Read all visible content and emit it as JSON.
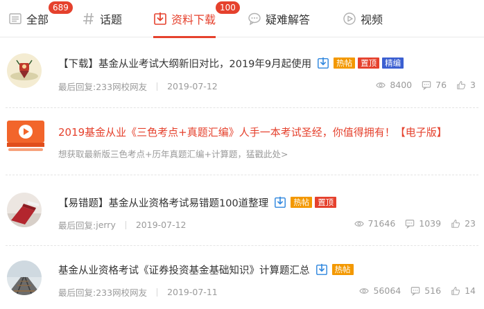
{
  "tabs": [
    {
      "label": "全部",
      "badge": "689",
      "icon": "list-icon",
      "active": false
    },
    {
      "label": "话题",
      "badge": "",
      "icon": "hash-icon",
      "active": false
    },
    {
      "label": "资料下载",
      "badge": "100",
      "icon": "download-icon",
      "active": true
    },
    {
      "label": "疑难解答",
      "badge": "",
      "icon": "chat-icon",
      "active": false
    },
    {
      "label": "视频",
      "badge": "",
      "icon": "play-icon",
      "active": false
    }
  ],
  "posts": [
    {
      "title": "【下载】基金从业考试大纲新旧对比，2019年9月起使用",
      "tags": [
        "热帖",
        "置顶",
        "精编"
      ],
      "last_reply_label": "最后回复:",
      "last_reply_user": "233网校网友",
      "date": "2019-07-12",
      "views": "8400",
      "comments": "76",
      "likes": "3"
    },
    {
      "title": "2019基金从业《三色考点+真题汇编》人手一本考试圣经，你值得拥有！【电子版】",
      "subtitle": "想获取最新版三色考点+历年真题汇编+计算题，猛戳此处>"
    },
    {
      "title": "【易错题】基金从业资格考试易错题100道整理",
      "tags": [
        "热帖",
        "置顶"
      ],
      "last_reply_label": "最后回复:",
      "last_reply_user": "jerry",
      "date": "2019-07-12",
      "views": "71646",
      "comments": "1039",
      "likes": "23"
    },
    {
      "title": "基金从业资格考试《证券投资基金基础知识》计算题汇总",
      "tags": [
        "热帖"
      ],
      "last_reply_label": "最后回复:",
      "last_reply_user": "233网校网友",
      "date": "2019-07-11",
      "views": "56064",
      "comments": "516",
      "likes": "14"
    }
  ],
  "colors": {
    "accent": "#e5412d",
    "hot": "#f39800",
    "fine": "#3b5fd1",
    "muted": "#9a9a9a"
  }
}
